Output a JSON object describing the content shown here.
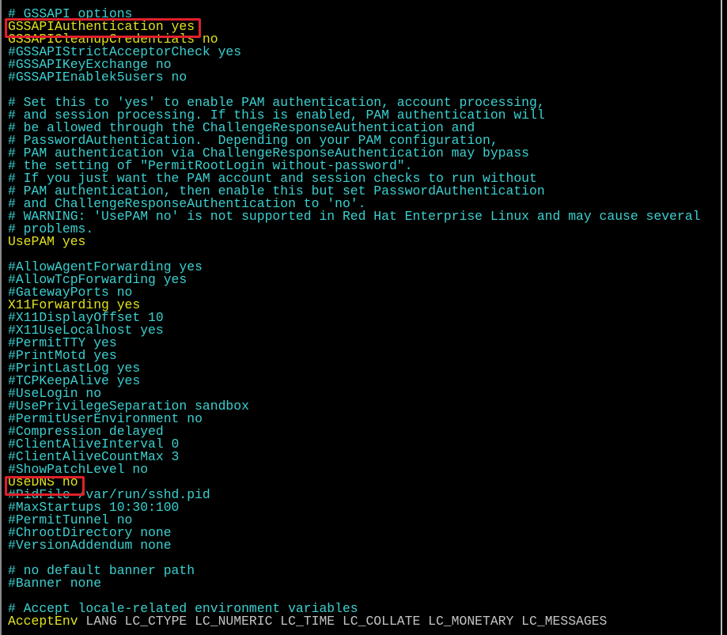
{
  "colors": {
    "comment": "#3cd0d0",
    "setting": "#e2e21e",
    "args": "#c4c4c4",
    "highlight": "#e0202a",
    "background": "#000000"
  },
  "lines": [
    {
      "type": "comment",
      "text": "# GSSAPI options"
    },
    {
      "type": "setting",
      "text": "GSSAPIAuthentication yes",
      "highlighted": true
    },
    {
      "type": "setting",
      "text": "GSSAPICleanupCredentials no"
    },
    {
      "type": "comment",
      "text": "#GSSAPIStrictAcceptorCheck yes"
    },
    {
      "type": "comment",
      "text": "#GSSAPIKeyExchange no"
    },
    {
      "type": "comment",
      "text": "#GSSAPIEnablek5users no"
    },
    {
      "type": "blank",
      "text": ""
    },
    {
      "type": "comment",
      "text": "# Set this to 'yes' to enable PAM authentication, account processing,"
    },
    {
      "type": "comment",
      "text": "# and session processing. If this is enabled, PAM authentication will"
    },
    {
      "type": "comment",
      "text": "# be allowed through the ChallengeResponseAuthentication and"
    },
    {
      "type": "comment",
      "text": "# PasswordAuthentication.  Depending on your PAM configuration,"
    },
    {
      "type": "comment",
      "text": "# PAM authentication via ChallengeResponseAuthentication may bypass"
    },
    {
      "type": "comment",
      "text": "# the setting of \"PermitRootLogin without-password\"."
    },
    {
      "type": "comment",
      "text": "# If you just want the PAM account and session checks to run without"
    },
    {
      "type": "comment",
      "text": "# PAM authentication, then enable this but set PasswordAuthentication"
    },
    {
      "type": "comment",
      "text": "# and ChallengeResponseAuthentication to 'no'."
    },
    {
      "type": "comment",
      "text": "# WARNING: 'UsePAM no' is not supported in Red Hat Enterprise Linux and may cause several"
    },
    {
      "type": "comment",
      "text": "# problems."
    },
    {
      "type": "setting",
      "text": "UsePAM yes"
    },
    {
      "type": "blank",
      "text": ""
    },
    {
      "type": "comment",
      "text": "#AllowAgentForwarding yes"
    },
    {
      "type": "comment",
      "text": "#AllowTcpForwarding yes"
    },
    {
      "type": "comment",
      "text": "#GatewayPorts no"
    },
    {
      "type": "setting",
      "text": "X11Forwarding yes"
    },
    {
      "type": "comment",
      "text": "#X11DisplayOffset 10"
    },
    {
      "type": "comment",
      "text": "#X11UseLocalhost yes"
    },
    {
      "type": "comment",
      "text": "#PermitTTY yes"
    },
    {
      "type": "comment",
      "text": "#PrintMotd yes"
    },
    {
      "type": "comment",
      "text": "#PrintLastLog yes"
    },
    {
      "type": "comment",
      "text": "#TCPKeepAlive yes"
    },
    {
      "type": "comment",
      "text": "#UseLogin no"
    },
    {
      "type": "comment",
      "text": "#UsePrivilegeSeparation sandbox"
    },
    {
      "type": "comment",
      "text": "#PermitUserEnvironment no"
    },
    {
      "type": "comment",
      "text": "#Compression delayed"
    },
    {
      "type": "comment",
      "text": "#ClientAliveInterval 0"
    },
    {
      "type": "comment",
      "text": "#ClientAliveCountMax 3"
    },
    {
      "type": "comment",
      "text": "#ShowPatchLevel no"
    },
    {
      "type": "setting",
      "text": "UseDNS no",
      "highlighted": true
    },
    {
      "type": "comment",
      "text": "#PidFile /var/run/sshd.pid"
    },
    {
      "type": "comment",
      "text": "#MaxStartups 10:30:100"
    },
    {
      "type": "comment",
      "text": "#PermitTunnel no"
    },
    {
      "type": "comment",
      "text": "#ChrootDirectory none"
    },
    {
      "type": "comment",
      "text": "#VersionAddendum none"
    },
    {
      "type": "blank",
      "text": ""
    },
    {
      "type": "comment",
      "text": "# no default banner path"
    },
    {
      "type": "comment",
      "text": "#Banner none"
    },
    {
      "type": "blank",
      "text": ""
    },
    {
      "type": "comment",
      "text": "# Accept locale-related environment variables"
    },
    {
      "type": "keyargs",
      "key": "AcceptEnv",
      "args": " LANG LC_CTYPE LC_NUMERIC LC_TIME LC_COLLATE LC_MONETARY LC_MESSAGES"
    }
  ]
}
